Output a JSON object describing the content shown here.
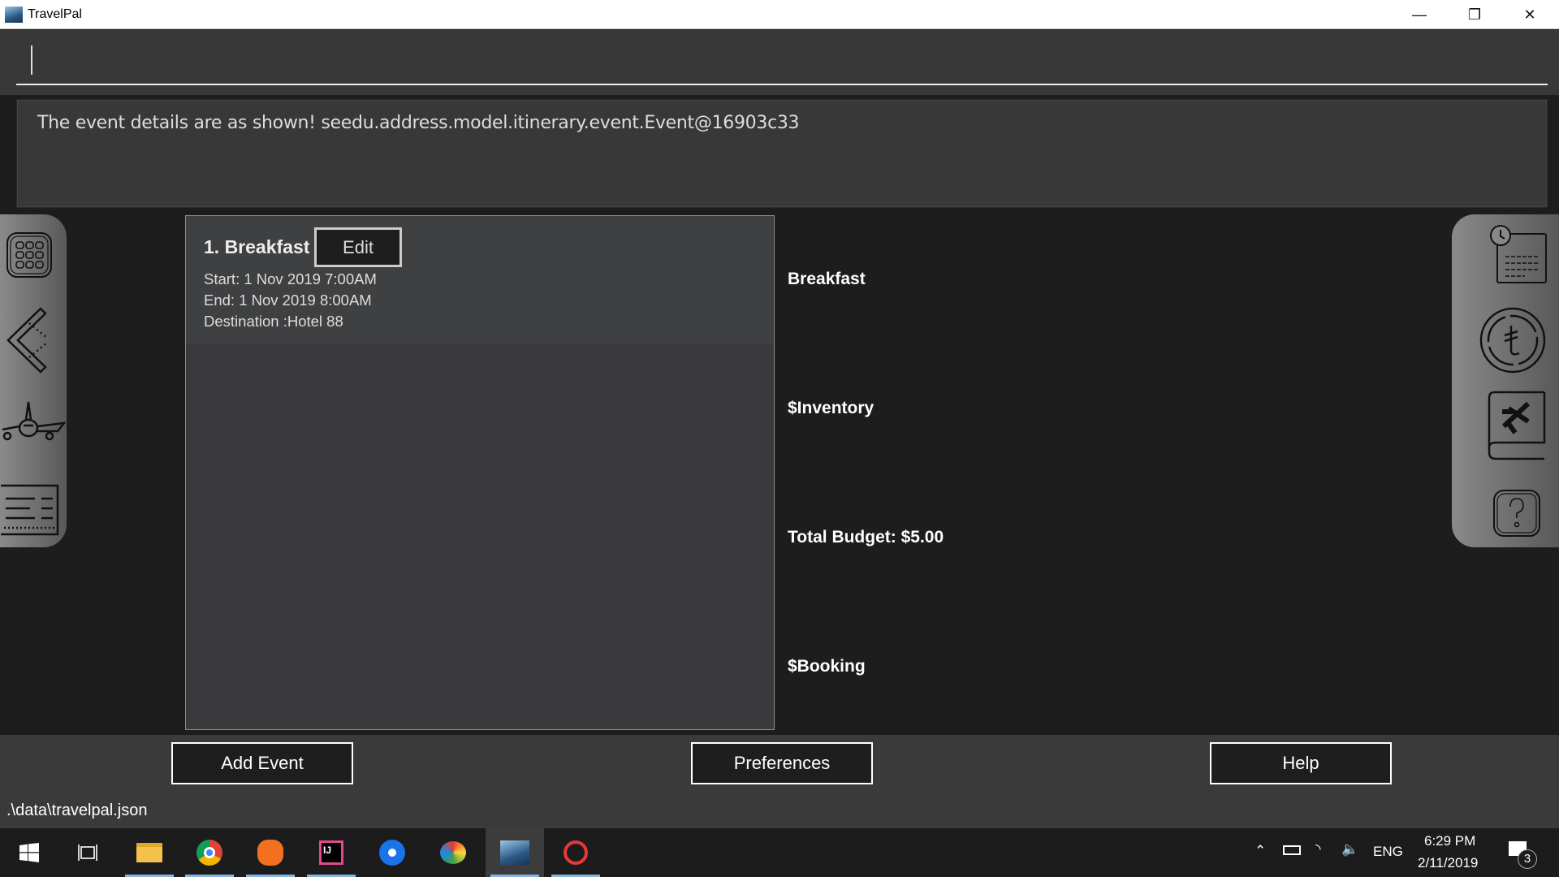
{
  "window": {
    "title": "TravelPal",
    "minimize_icon": "minimize-icon",
    "restore_icon": "restore-icon",
    "close_icon": "close-icon"
  },
  "command_box": {
    "value": ""
  },
  "result_display": {
    "text": "The event details are as shown! seedu.address.model.itinerary.event.Event@16903c33"
  },
  "left_sidebar": {
    "items": [
      "grid-menu-icon",
      "back-icon",
      "airplane-icon",
      "itinerary-list-icon"
    ]
  },
  "right_sidebar": {
    "items": [
      "calendar-icon",
      "currency-icon",
      "booking-book-icon",
      "help-icon"
    ]
  },
  "event_list": {
    "events": [
      {
        "title": "1. Breakfast",
        "edit_label": "Edit",
        "start": "Start: 1 Nov 2019 7:00AM",
        "end": "End: 1 Nov 2019 8:00AM",
        "destination": "Destination :Hotel 88"
      }
    ]
  },
  "event_detail": {
    "name": "Breakfast",
    "inventory": "$Inventory",
    "budget": "Total Budget: $5.00",
    "booking": "$Booking"
  },
  "bottom_bar": {
    "add_event": "Add Event",
    "preferences": "Preferences",
    "help": "Help"
  },
  "status_bar": {
    "path": ".\\data\\travelpal.json"
  },
  "taskbar": {
    "language": "ENG",
    "time": "6:29 PM",
    "date": "2/11/2019",
    "notifications": "3",
    "apps": [
      "start",
      "task-view",
      "file-explorer",
      "chrome",
      "brave",
      "intellij",
      "maps",
      "paint",
      "travelpal",
      "snipping-tool"
    ]
  }
}
